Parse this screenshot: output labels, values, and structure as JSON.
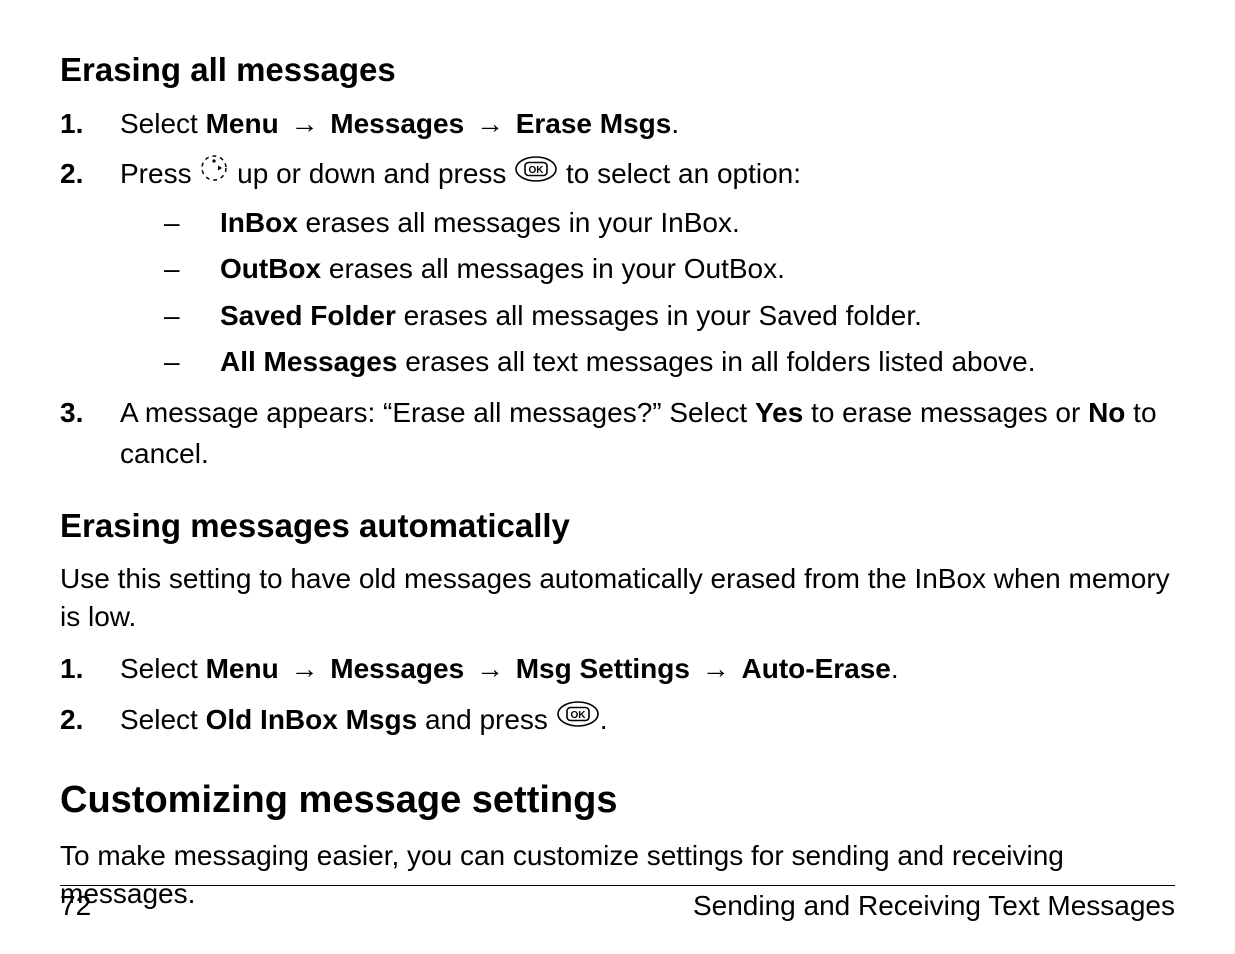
{
  "section1": {
    "heading": "Erasing all messages",
    "step1": {
      "pre": "Select ",
      "menu": "Menu",
      "messages": "Messages",
      "erase": "Erase Msgs",
      "end": "."
    },
    "step2": {
      "pre": "Press ",
      "mid": " up or down and press ",
      "post": " to select an option:",
      "items": [
        {
          "term": "InBox",
          "desc": " erases all messages in your InBox."
        },
        {
          "term": "OutBox",
          "desc": " erases all messages in your OutBox."
        },
        {
          "term": "Saved Folder",
          "desc": " erases all messages in your Saved folder."
        },
        {
          "term": "All Messages",
          "desc": " erases all text messages in all folders listed above."
        }
      ]
    },
    "step3": {
      "p1": "A message appears: “Erase all messages?” Select ",
      "yes": "Yes",
      "p2": " to erase messages or ",
      "no": "No",
      "p3": " to cancel."
    }
  },
  "section2": {
    "heading": "Erasing messages automatically",
    "intro": "Use this setting to have old messages automatically erased from the InBox when memory is low.",
    "step1": {
      "pre": "Select ",
      "menu": "Menu",
      "messages": "Messages",
      "settings": "Msg Settings",
      "auto": "Auto-Erase",
      "end": "."
    },
    "step2": {
      "pre": "Select ",
      "old": "Old InBox Msgs",
      "mid": " and press ",
      "end": "."
    }
  },
  "section3": {
    "heading": "Customizing message settings",
    "intro": "To make messaging easier, you can customize settings for sending and receiving messages."
  },
  "footer": {
    "page": "72",
    "chapter": "Sending and Receiving Text Messages"
  },
  "glyphs": {
    "arrow": "→"
  }
}
